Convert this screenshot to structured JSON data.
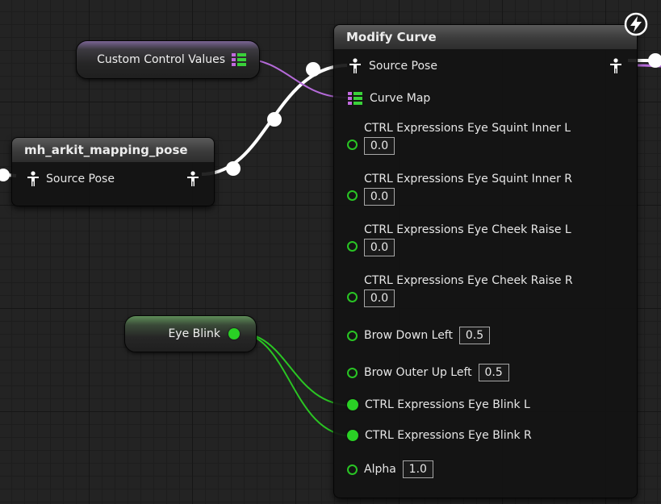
{
  "nodes": {
    "custom_control_values": {
      "label": "Custom Control Values",
      "color": "#9b64d1"
    },
    "eye_blink": {
      "label": "Eye Blink",
      "color": "#2ad125"
    },
    "mapping_pose": {
      "title": "mh_arkit_mapping_pose",
      "output_label": "Source Pose"
    },
    "modify_curve": {
      "title": "Modify Curve",
      "source_pose_label": "Source Pose",
      "curve_map_label": "Curve Map",
      "pins": [
        {
          "label": "CTRL Expressions Eye Squint Inner L",
          "value": "0.0"
        },
        {
          "label": "CTRL Expressions Eye Squint Inner R",
          "value": "0.0"
        },
        {
          "label": "CTRL Expressions Eye Cheek Raise L",
          "value": "0.0"
        },
        {
          "label": "CTRL Expressions Eye Cheek Raise R",
          "value": "0.0"
        },
        {
          "label": "Brow Down Left",
          "value": "0.5"
        },
        {
          "label": "Brow Outer Up Left",
          "value": "0.5"
        },
        {
          "label": "CTRL Expressions Eye Blink L",
          "value": ""
        },
        {
          "label": "CTRL Expressions Eye Blink R",
          "value": ""
        },
        {
          "label": "Alpha",
          "value": "1.0"
        }
      ]
    }
  },
  "icons": {
    "pose": "person-pose-icon",
    "curve_map": "map-grid-icon",
    "float_pin": "float-pin-icon",
    "exec": "lightning-bolt-icon"
  },
  "colors": {
    "pose_wire": "#ffffff",
    "map_wire": "#b56ad9",
    "float_wire": "#2ac523",
    "background": "#232323"
  }
}
